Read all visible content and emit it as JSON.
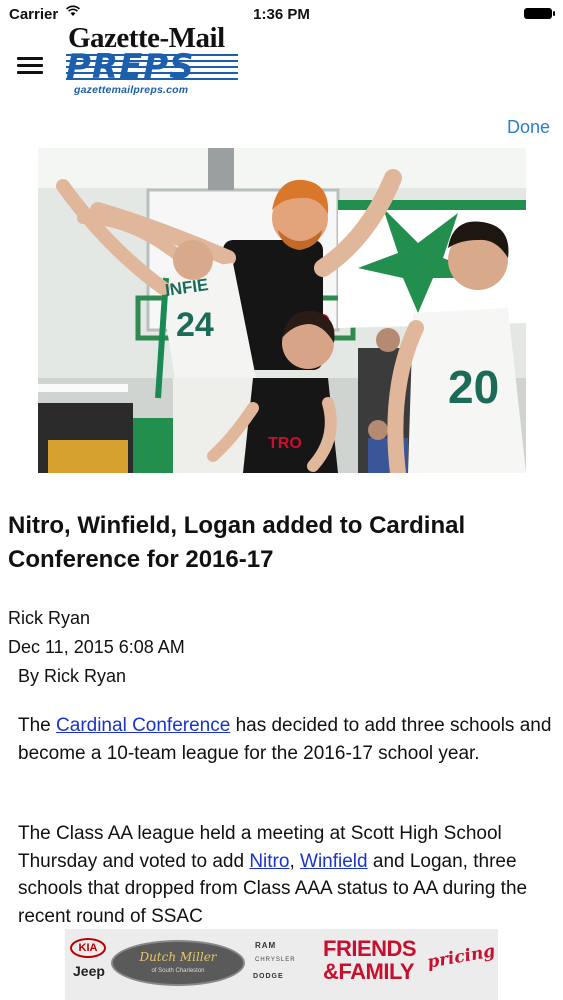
{
  "status_bar": {
    "carrier": "Carrier",
    "time": "1:36 PM"
  },
  "header": {
    "logo_top": "Gazette-Mail",
    "logo_main": "PREPS",
    "logo_url": "gazettemailpreps.com",
    "done_label": "Done"
  },
  "hero": {
    "jersey_left": "24",
    "jersey_left_school": "INFIE",
    "jersey_right": "20"
  },
  "article": {
    "title": "Nitro, Winfield, Logan added to Cardinal Conference for 2016-17",
    "author": "Rick Ryan",
    "date": "Dec 11, 2015 6:08 AM",
    "byline": "By Rick Ryan",
    "p1": {
      "pre": "The ",
      "link": "Cardinal Conference",
      "post": " has decided to add three schools and become a 10-team league for the 2016-17 school year."
    },
    "p2": {
      "pre": "The Class AA league held a meeting at Scott High School Thursday and voted to add ",
      "link1": "Nitro",
      "mid": ", ",
      "link2": "Winfield",
      "post": " and Logan, three schools that dropped from Class AAA status to AA during the recent round of SSAC"
    }
  },
  "ad": {
    "brand1": "KIA",
    "brand2": "Jeep",
    "dealer_name": "Dutch Miller",
    "dealer_sub": "of South Charleston",
    "brand3": "RAM",
    "brand4": "CHRYSLER",
    "brand5": "DODGE",
    "headline1": "FRIENDS",
    "headline2": "&FAMILY",
    "headline3": "pricing"
  },
  "colors": {
    "link": "#1a34c9",
    "done": "#2a7fd4",
    "logo_blue": "#1b5fad",
    "ad_red": "#c8102e"
  },
  "icons": [
    "wifi-icon",
    "battery-icon",
    "menu-icon"
  ]
}
